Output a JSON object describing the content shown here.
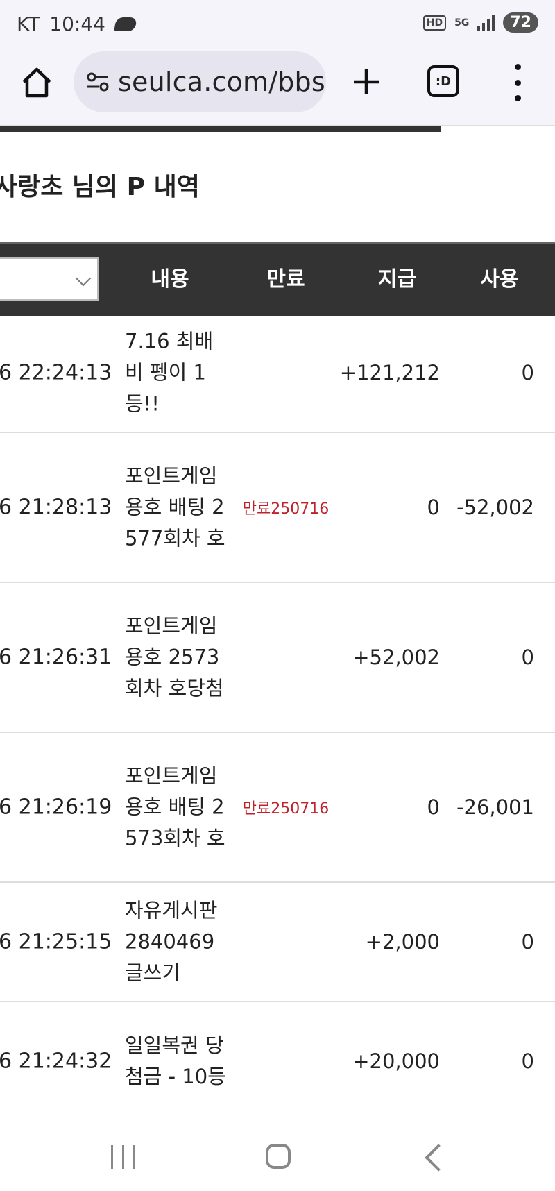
{
  "status_bar": {
    "carrier": "KT",
    "time": "10:44",
    "hd_label": "HD",
    "network_label": "5G",
    "battery": "72"
  },
  "browser": {
    "url": "seulca.com/bbs"
  },
  "page": {
    "title": "사랑초 님의 P 내역"
  },
  "table": {
    "headers": {
      "content": "내용",
      "expiry": "만료",
      "pay": "지급",
      "use": "사용"
    },
    "rows": [
      {
        "date": "6 22:24:13",
        "content": "7.16 최배비 펭이 1등!!",
        "expiry": "",
        "pay": "+121,212",
        "use": "0"
      },
      {
        "date": "6 21:28:13",
        "content": "포인트게임 용호 배팅 2577회차 호",
        "expiry": "만료250716",
        "pay": "0",
        "use": "-52,002"
      },
      {
        "date": "6 21:26:31",
        "content": "포인트게임 용호 2573회차 호당첨",
        "expiry": "",
        "pay": "+52,002",
        "use": "0"
      },
      {
        "date": "6 21:26:19",
        "content": "포인트게임 용호 배팅 2573회차 호",
        "expiry": "만료250716",
        "pay": "0",
        "use": "-26,001"
      },
      {
        "date": "6 21:25:15",
        "content": "자유게시판 2840469 글쓰기",
        "expiry": "",
        "pay": "+2,000",
        "use": "0"
      },
      {
        "date": "6 21:24:32",
        "content": "일일복권 당첨금 - 10등",
        "expiry": "",
        "pay": "+20,000",
        "use": "0"
      }
    ]
  }
}
